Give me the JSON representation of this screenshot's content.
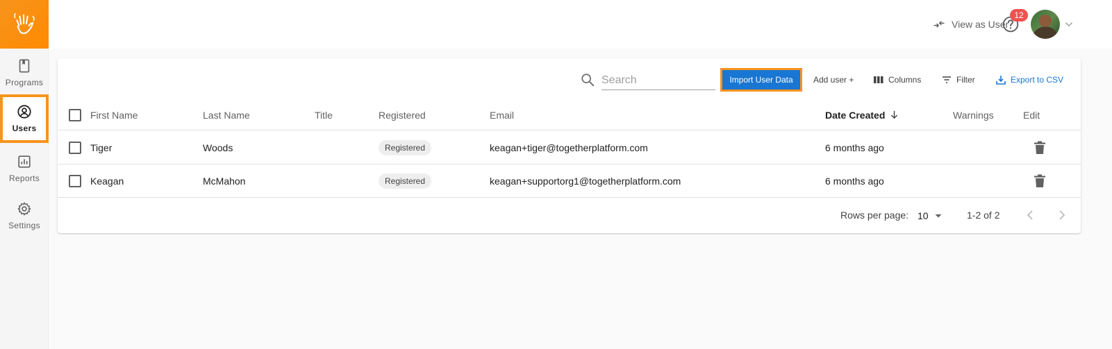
{
  "sidebar": {
    "logo": "hand-wave-logo",
    "items": [
      {
        "label": "Programs",
        "icon": "book-icon",
        "active": false
      },
      {
        "label": "Users",
        "icon": "user-circle-icon",
        "active": true
      },
      {
        "label": "Reports",
        "icon": "bar-chart-icon",
        "active": false
      },
      {
        "label": "Settings",
        "icon": "gear-icon",
        "active": false
      }
    ]
  },
  "header": {
    "view_as_user_label": "View as User",
    "notification_count": "12"
  },
  "toolbar": {
    "search_placeholder": "Search",
    "import_label": "Import User Data",
    "add_user_label": "Add user +",
    "columns_label": "Columns",
    "filter_label": "Filter",
    "export_label": "Export to CSV"
  },
  "table": {
    "columns": [
      "First Name",
      "Last Name",
      "Title",
      "Registered",
      "Email",
      "Date Created",
      "Warnings",
      "Edit"
    ],
    "sorted_column": "Date Created",
    "sort_direction": "desc",
    "rows": [
      {
        "first": "Tiger",
        "last": "Woods",
        "title": "",
        "registered": "Registered",
        "email": "keagan+tiger@togetherplatform.com",
        "created": "6 months ago",
        "warnings": ""
      },
      {
        "first": "Keagan",
        "last": "McMahon",
        "title": "",
        "registered": "Registered",
        "email": "keagan+supportorg1@togetherplatform.com",
        "created": "6 months ago",
        "warnings": ""
      }
    ]
  },
  "pagination": {
    "rows_per_page_label": "Rows per page:",
    "rows_per_page": "10",
    "range": "1-2 of 2"
  },
  "colors": {
    "brand_orange": "#f7941d",
    "primary_blue": "#1976d2",
    "badge_red": "#ef5350"
  }
}
